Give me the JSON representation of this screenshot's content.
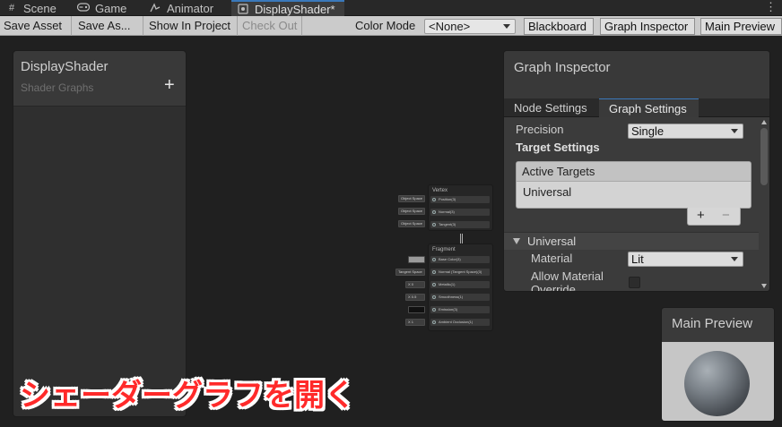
{
  "tabs": [
    {
      "label": "Scene",
      "icon": "scene-hash-icon"
    },
    {
      "label": "Game",
      "icon": "gamepad-icon"
    },
    {
      "label": "Animator",
      "icon": "animator-icon"
    },
    {
      "label": "DisplayShader*",
      "icon": "shader-graph-icon",
      "active": true
    }
  ],
  "toolbar": {
    "save_asset": "Save Asset",
    "save_as": "Save As...",
    "show_in_project": "Show In Project",
    "check_out": "Check Out",
    "color_mode_label": "Color Mode",
    "color_mode_value": "<None>",
    "blackboard": "Blackboard",
    "graph_inspector": "Graph Inspector",
    "main_preview": "Main Preview"
  },
  "blackboard": {
    "title": "DisplayShader",
    "subtitle": "Shader Graphs",
    "add_symbol": "+"
  },
  "master_stack": {
    "vertex": {
      "title": "Vertex",
      "ports": [
        "Position(3)",
        "Normal(3)",
        "Tangent(3)"
      ],
      "inputs": [
        "Object Space",
        "Object Space",
        "Object Space"
      ]
    },
    "fragment": {
      "title": "Fragment",
      "ports": [
        "Base Color(3)",
        "Normal (Tangent Space)(3)",
        "Metallic(1)",
        "Smoothness(1)",
        "Emission(3)",
        "Ambient Occlusion(1)"
      ],
      "inputs": [
        "",
        "Tangent Space",
        "X 0",
        "X 0.5",
        "",
        "X 1"
      ]
    }
  },
  "graph_inspector": {
    "title": "Graph Inspector",
    "tabs": [
      "Node Settings",
      "Graph Settings"
    ],
    "active_tab": "Graph Settings",
    "precision_label": "Precision",
    "precision_value": "Single",
    "target_settings_label": "Target Settings",
    "active_targets_label": "Active Targets",
    "targets": [
      "Universal"
    ],
    "add_symbol": "+",
    "remove_symbol": "−",
    "section_universal": "Universal",
    "material_label": "Material",
    "material_value": "Lit",
    "allow_override_label_1": "Allow Material",
    "allow_override_label_2": "Override"
  },
  "main_preview": {
    "title": "Main Preview"
  },
  "overlay_caption": "シェーダーグラフを開く",
  "colors": {
    "background": "#202020",
    "caption": "#ff2a2a",
    "accent_tab": "#3a79bb"
  }
}
